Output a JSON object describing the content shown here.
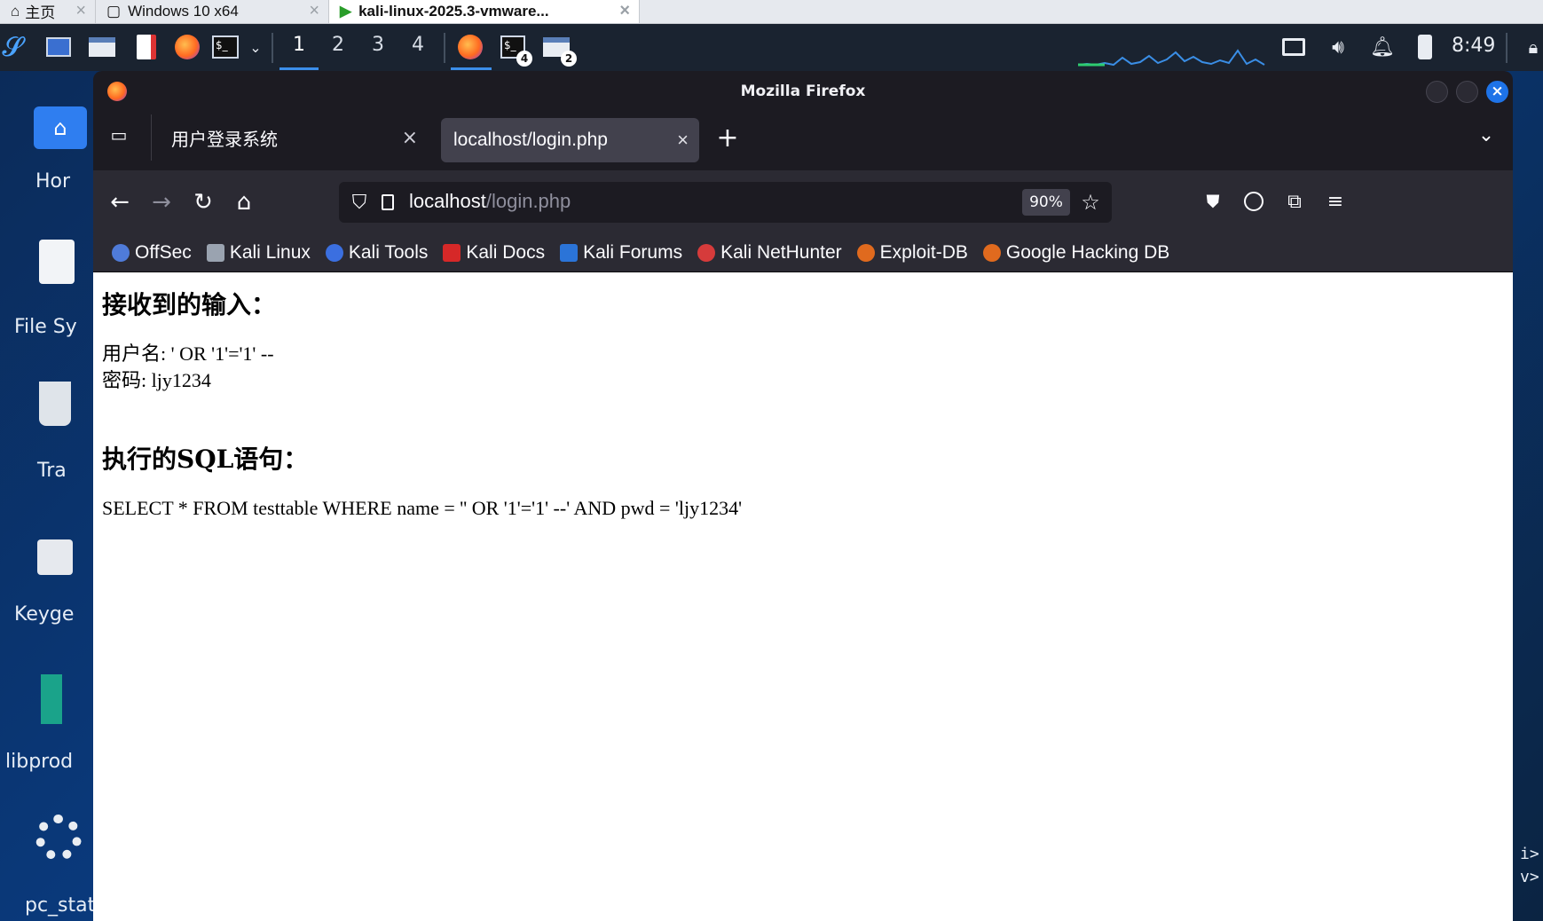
{
  "vm_tabs": [
    {
      "label": "主页",
      "active": false
    },
    {
      "label": "Windows 10 x64",
      "active": false
    },
    {
      "label": "kali-linux-2025.3-vmware...",
      "active": true
    }
  ],
  "panel": {
    "workspaces": [
      "1",
      "2",
      "3",
      "4"
    ],
    "terminal_badge": "4",
    "files_badge": "2",
    "clock": "8:49"
  },
  "desktop": {
    "icons": [
      "Hor",
      "File Sy",
      "Tra",
      "Keyge",
      "libprod",
      "pc_stati"
    ]
  },
  "window": {
    "title": "Mozilla Firefox"
  },
  "tabs": [
    {
      "label": "用户登录系统",
      "active": false
    },
    {
      "label": "localhost/login.php",
      "active": true
    }
  ],
  "urlbar": {
    "host": "localhost",
    "path": "/login.php",
    "zoom": "90%"
  },
  "bookmarks": [
    {
      "label": "OffSec",
      "color": "#4f7bd9"
    },
    {
      "label": "Kali Linux",
      "color": "#9aa3b0"
    },
    {
      "label": "Kali Tools",
      "color": "#3b6fe0"
    },
    {
      "label": "Kali Docs",
      "color": "#d62828"
    },
    {
      "label": "Kali Forums",
      "color": "#2b74d8"
    },
    {
      "label": "Kali NetHunter",
      "color": "#d63b3b"
    },
    {
      "label": "Exploit-DB",
      "color": "#e06a1e"
    },
    {
      "label": "Google Hacking DB",
      "color": "#e06a1e"
    }
  ],
  "page": {
    "heading_input": "接收到的输入：",
    "username_line": "用户名: ' OR '1'='1' --",
    "password_line": "密码: ljy1234",
    "heading_sql": "执行的SQL语句：",
    "sql_line": "SELECT * FROM testtable WHERE name = '' OR '1'='1' --' AND pwd = 'ljy1234'"
  },
  "side_terminal": {
    "line1": "i>",
    "line2": "v>"
  }
}
